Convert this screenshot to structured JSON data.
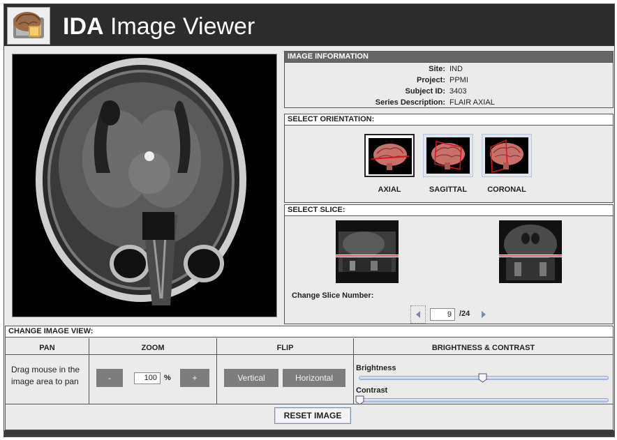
{
  "header": {
    "title_bold": "IDA",
    "title_rest": " Image Viewer",
    "logo_icon": "brain-logo-icon"
  },
  "viewer": {
    "image_icon": "mri-axial-scan-image"
  },
  "image_information": {
    "title": "IMAGE INFORMATION",
    "rows": [
      {
        "label": "Site:",
        "value": "IND"
      },
      {
        "label": "Project:",
        "value": "PPMI"
      },
      {
        "label": "Subject ID:",
        "value": "3403"
      },
      {
        "label": "Series Description:",
        "value": "FLAIR AXIAL"
      }
    ]
  },
  "orientation": {
    "title": "SELECT ORIENTATION:",
    "options": [
      {
        "label": "AXIAL",
        "selected": true
      },
      {
        "label": "SAGITTAL",
        "selected": false
      },
      {
        "label": "CORONAL",
        "selected": false
      }
    ]
  },
  "slice": {
    "title": "SELECT SLICE:",
    "change_label": "Change Slice Number:",
    "current": "9",
    "total": "/24"
  },
  "change_view": {
    "title": "CHANGE IMAGE VIEW:",
    "pan": {
      "header": "PAN",
      "text_line1": "Drag mouse in the",
      "text_line2": "image area to pan"
    },
    "zoom": {
      "header": "ZOOM",
      "minus": "-",
      "value": "100",
      "unit": "%",
      "plus": "+"
    },
    "flip": {
      "header": "FLIP",
      "vertical": "Vertical",
      "horizontal": "Horizontal"
    },
    "brightness_contrast": {
      "header": "BRIGHTNESS & CONTRAST",
      "brightness_label": "Brightness",
      "brightness_level": 0.5,
      "contrast_label": "Contrast",
      "contrast_level": 0.0
    }
  },
  "reset_label": "RESET IMAGE",
  "colors": {
    "header_bg": "#2c2c2c",
    "panel_bg": "#ebebeb",
    "button_gray": "#7d7d7d",
    "slider_blue": "#8ea4c8",
    "slice_line": "#d01030"
  }
}
